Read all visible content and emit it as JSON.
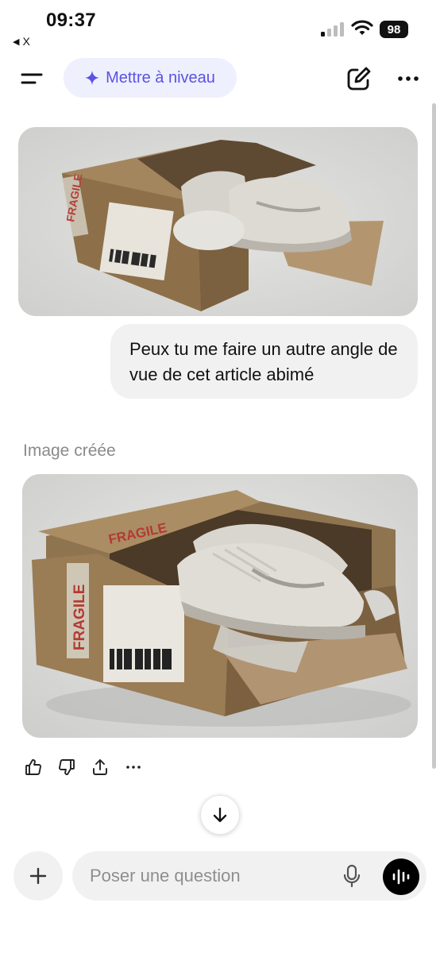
{
  "status_bar": {
    "time": "09:37",
    "back_label": "X",
    "battery": "98"
  },
  "header": {
    "upgrade_label": "Mettre à niveau",
    "upgrade_icon": "sparkle-icon",
    "accent_color": "#5b52e0"
  },
  "conversation": {
    "user_image_description_icon": "image",
    "user_message": "Peux tu me faire un autre angle de vue de cet article abimé",
    "assistant_label": "Image créée"
  },
  "actions": [
    "thumbs-up-icon",
    "thumbs-down-icon",
    "share-icon",
    "more-icon"
  ],
  "composer": {
    "placeholder": "Poser une question"
  }
}
